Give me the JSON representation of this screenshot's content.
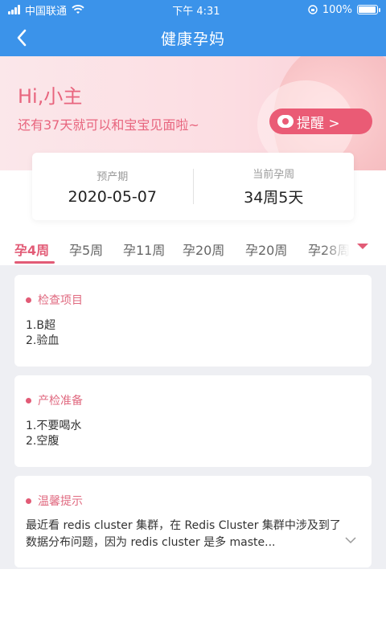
{
  "status_bar": {
    "carrier": "中国联通",
    "time": "下午 4:31",
    "battery": "100%"
  },
  "nav": {
    "title": "健康孕妈"
  },
  "banner": {
    "greeting": "Hi,小主",
    "countdown": "还有37天就可以和宝宝见面啦~",
    "remind_label": "提醒 >"
  },
  "info": {
    "due_label": "预产期",
    "due_value": "2020-05-07",
    "week_label": "当前孕周",
    "week_value": "34周5天"
  },
  "tabs": [
    {
      "label": "孕4周"
    },
    {
      "label": "孕5周"
    },
    {
      "label": "孕11周"
    },
    {
      "label": "孕20周"
    },
    {
      "label": "孕20周"
    },
    {
      "label": "孕28周"
    }
  ],
  "cards": {
    "exam": {
      "title": "检查项目",
      "lines": [
        "1.B超",
        "2.验血"
      ]
    },
    "prep": {
      "title": "产检准备",
      "lines": [
        "1.不要喝水",
        "2.空腹"
      ]
    },
    "tip": {
      "title": "温馨提示",
      "text": "最近看 redis cluster 集群，在 Redis Cluster 集群中涉及到了数据分布问题，因为 redis cluster 是多 maste..."
    }
  },
  "icons": {
    "back": "chevron-left-icon",
    "remind": "alarm-clock-icon",
    "dropdown": "triangle-down-icon",
    "expand": "chevron-down-icon"
  },
  "colors": {
    "primary_blue": "#3b93ea",
    "accent_pink": "#e25b76"
  }
}
